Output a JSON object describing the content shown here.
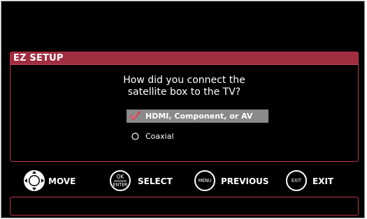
{
  "panel": {
    "title": "EZ SETUP",
    "question": "How did you connect the\nsatellite box to the TV?",
    "options": [
      {
        "label": "HDMI, Component, or AV",
        "selected": true
      },
      {
        "label": "Coaxial",
        "selected": false
      }
    ]
  },
  "nav": {
    "move_label": "MOVE",
    "select_label": "SELECT",
    "ok_btn_top": "OK",
    "ok_btn_bottom": "ENTER",
    "previous_label": "PREVIOUS",
    "menu_btn_text": "MENU",
    "exit_label": "EXIT",
    "exit_btn_text": "EXIT"
  },
  "colors": {
    "accent": "#a02c40",
    "border": "#b8324a",
    "selected_bg": "#8a8a8a",
    "check": "#c0203a",
    "background": "#000000"
  },
  "icons": {
    "selected_option": "checkmark-icon",
    "unselected_option": "radio-circle-icon",
    "move": "dpad-icon",
    "select": "ok-enter-button-icon",
    "previous": "menu-button-icon",
    "exit": "exit-button-icon"
  }
}
